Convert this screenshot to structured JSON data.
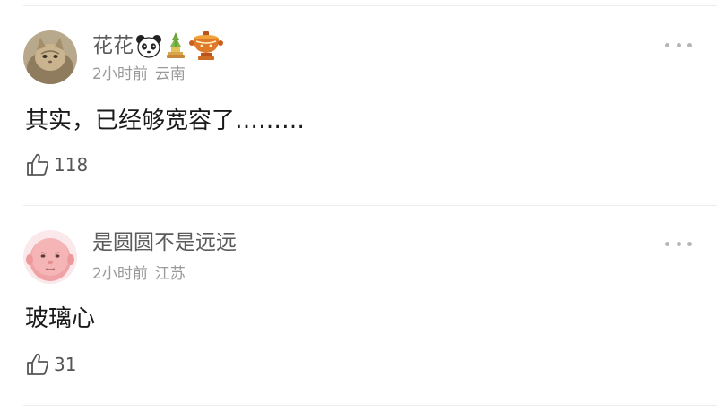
{
  "comments": [
    {
      "username": "花花",
      "time": "2小时前",
      "location": "云南",
      "text": "其实，已经够宽容了………",
      "likes": "118",
      "avatar_icon": "cat-avatar",
      "badges": [
        "panda-emoji-icon",
        "pine-decoration-icon",
        "hotpot-badge-icon"
      ]
    },
    {
      "username": "是圆圆不是远远",
      "time": "2小时前",
      "location": "江苏",
      "text": "玻璃心",
      "likes": "31",
      "avatar_icon": "pink-face-avatar",
      "badges": []
    }
  ],
  "icons": {
    "like": "thumbs-up-icon",
    "more": "more-options-icon"
  },
  "colors": {
    "username": "#5b5b5b",
    "meta": "#9a9a9a",
    "content": "#1a1a1a",
    "divider": "#ececec"
  }
}
